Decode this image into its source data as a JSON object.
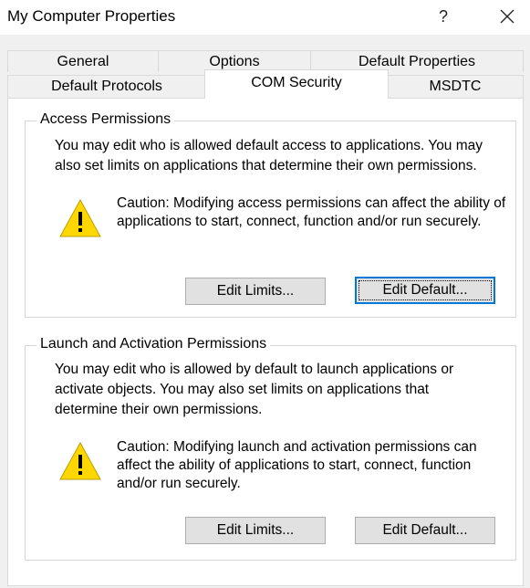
{
  "window": {
    "title": "My Computer Properties",
    "help_glyph": "?",
    "close_glyph": "✕"
  },
  "tabs": {
    "row1": [
      "General",
      "Options",
      "Default Properties"
    ],
    "row2": [
      "Default Protocols",
      "COM Security",
      "MSDTC"
    ],
    "active": "COM Security"
  },
  "access": {
    "title": "Access Permissions",
    "description": "You may edit who is allowed default access to applications. You may also set limits on applications that determine their own permissions.",
    "caution": "Caution: Modifying access permissions can affect the ability of applications to start, connect, function and/or run securely.",
    "edit_limits_label": "Edit Limits...",
    "edit_default_label": "Edit Default..."
  },
  "launch": {
    "title": "Launch and Activation Permissions",
    "description": "You may edit who is allowed by default to launch applications or activate objects. You may also set limits on applications that determine their own permissions.",
    "caution": "Caution: Modifying launch and activation permissions can affect the ability of applications to start, connect, function and/or run securely.",
    "edit_limits_label": "Edit Limits...",
    "edit_default_label": "Edit Default..."
  },
  "icons": {
    "warning": "warning-icon"
  },
  "colors": {
    "focus_border": "#0078d7",
    "warning_fill": "#ffd700"
  }
}
